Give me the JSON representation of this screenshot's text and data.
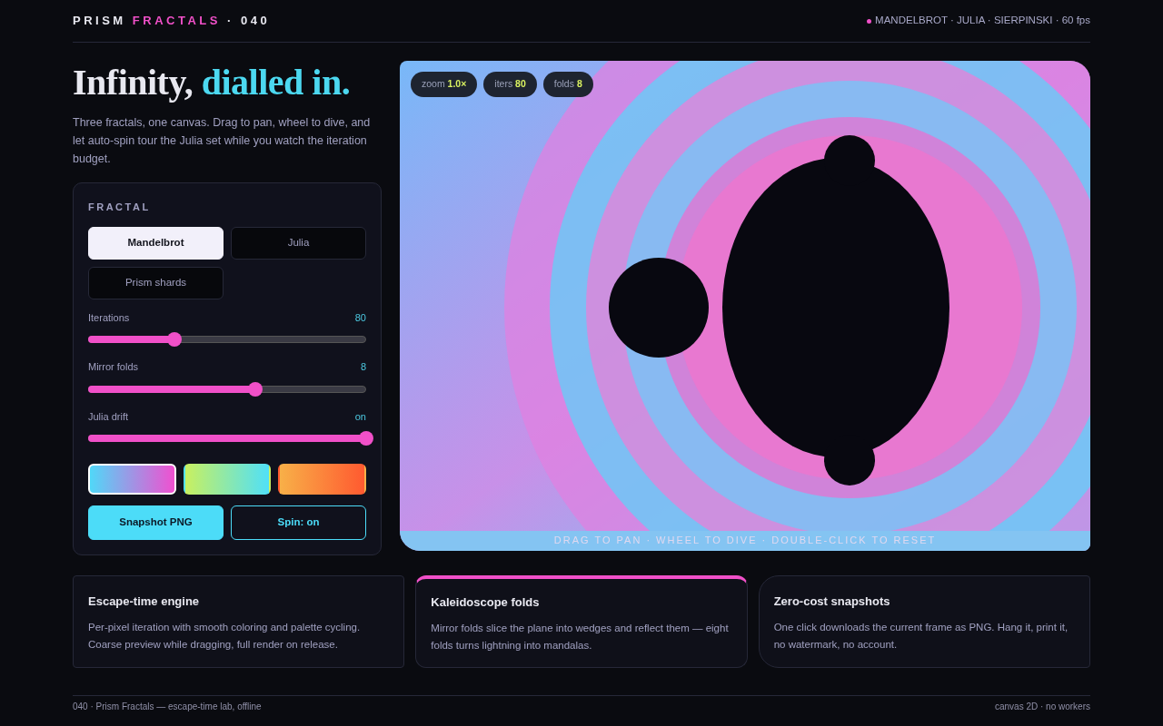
{
  "brand": {
    "first": "PRISM",
    "second": "FRACTALS",
    "suffix": "· 040"
  },
  "header_status": {
    "color": "#f050c8",
    "text": "MANDELBROT · JULIA · SIERPINSKI · 60 fps"
  },
  "hero": {
    "title_plain": "Infinity,",
    "title_accent": "dialled in.",
    "lead": "Three fractals, one canvas. Drag to pan, wheel to dive, and let auto-spin tour the Julia set while you watch the iteration budget."
  },
  "panel": {
    "heading": "FRACTAL",
    "fractals": [
      {
        "label": "Mandelbrot",
        "selected": true
      },
      {
        "label": "Julia",
        "selected": false
      },
      {
        "label": "Prism shards",
        "selected": false
      }
    ],
    "sliders": [
      {
        "label": "Iterations",
        "reading": "80",
        "level": 0.31
      },
      {
        "label": "Mirror folds",
        "reading": "8",
        "level": 0.6
      },
      {
        "label": "Julia drift",
        "reading": "on",
        "level": 1.0
      }
    ],
    "palettes": [
      {
        "selected": true
      },
      {
        "selected": false
      },
      {
        "selected": false
      }
    ],
    "buttons": [
      {
        "label": "Snapshot PNG",
        "kind": "solid"
      },
      {
        "label": "Spin: on",
        "kind": "outline"
      }
    ]
  },
  "canvas": {
    "chips": [
      {
        "label": "zoom",
        "value": "1.0×"
      },
      {
        "label": "iters",
        "value": "80"
      },
      {
        "label": "folds",
        "value": "8"
      }
    ],
    "hint": "DRAG TO PAN · WHEEL TO DIVE · DOUBLE-CLICK TO RESET"
  },
  "features": [
    {
      "title": "Escape-time engine",
      "text": "Per-pixel iteration with smooth coloring and palette cycling. Coarse preview while dragging, full render on release.",
      "selected": false
    },
    {
      "title": "Kaleidoscope folds",
      "text": "Mirror folds slice the plane into wedges and reflect them — eight folds turns lightning into mandalas.",
      "selected": true
    },
    {
      "title": "Zero-cost snapshots",
      "text": "One click downloads the current frame as PNG. Hang it, print it, no watermark, no account.",
      "selected": false
    }
  ],
  "footer": {
    "left": "040 · Prism Fractals — escape-time lab, offline",
    "right": "canvas 2D · no workers"
  }
}
